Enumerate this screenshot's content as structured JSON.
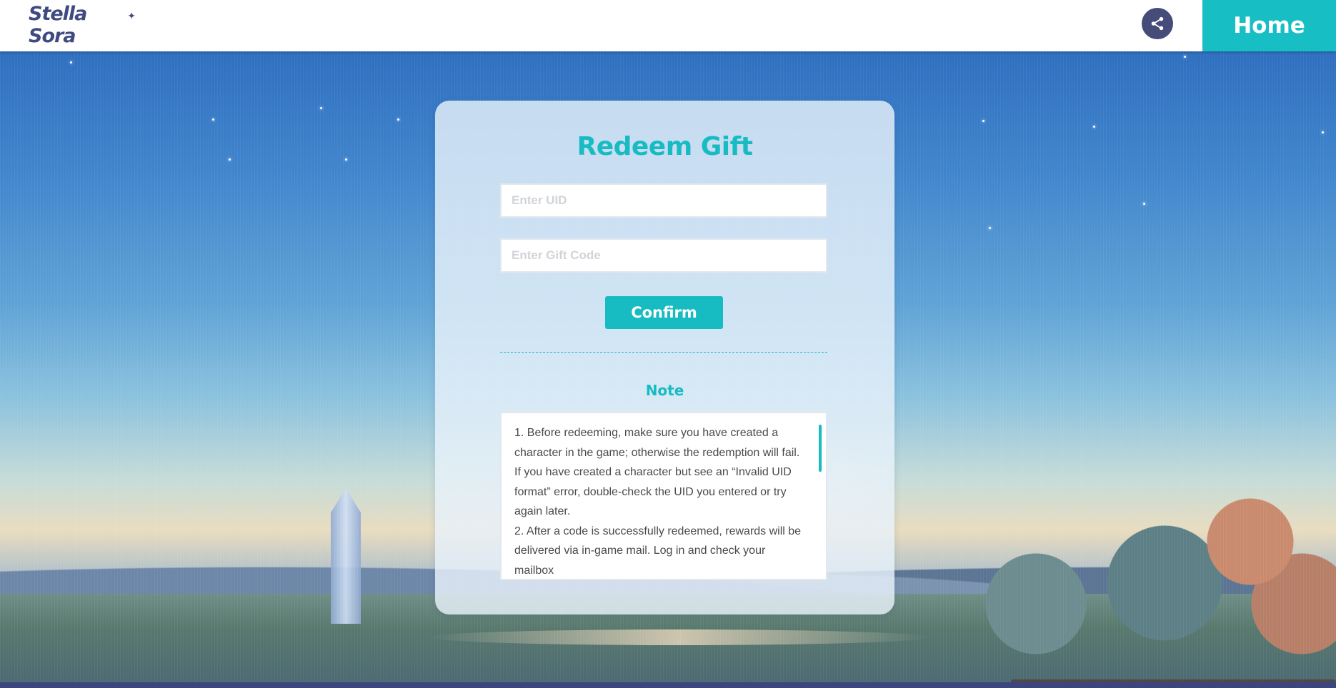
{
  "header": {
    "logo_text": "Stella Sora",
    "share_icon": "share-icon",
    "home_label": "Home"
  },
  "redeem": {
    "title": "Redeem Gift",
    "uid_placeholder": "Enter UID",
    "uid_value": "",
    "code_placeholder": "Enter Gift Code",
    "code_value": "",
    "confirm_label": "Confirm"
  },
  "note": {
    "title": "Note",
    "paragraphs": [
      "1. Before redeeming, make sure you have created a character in the game; otherwise the redemption will fail. If you have created a character but see an “Invalid UID format” error, double-check the UID you entered or try again later.",
      "2. After a code is successfully redeemed, rewards will be delivered via in-game mail. Log in and check your mailbox"
    ]
  },
  "colors": {
    "accent": "#17bcc3",
    "header_bg": "#ffffff",
    "share_button": "#454c7a",
    "logo": "#3f4a80"
  }
}
